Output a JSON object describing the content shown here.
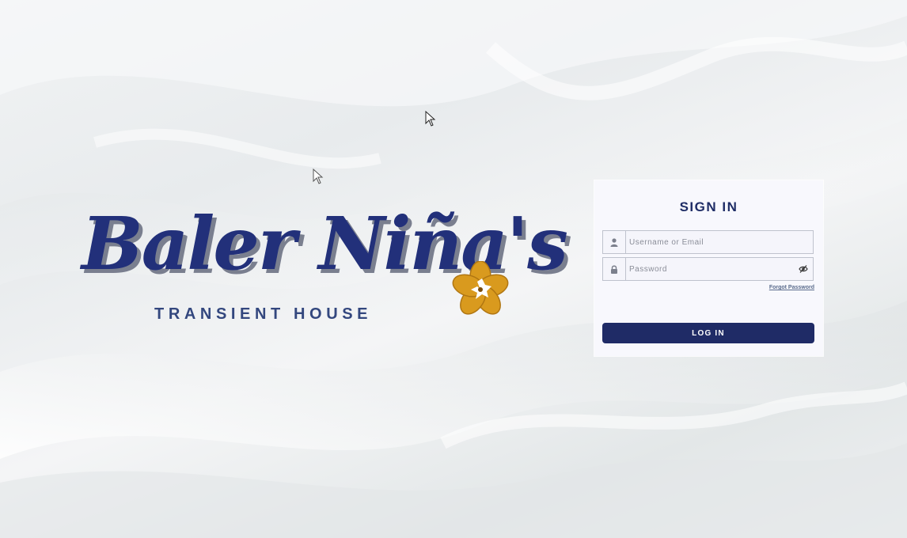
{
  "brand": {
    "name": "Baler Niña's",
    "tagline": "TRANSIENT HOUSE",
    "primary_color": "#22307a",
    "flower_color": "#d99a1e",
    "logo_icon": "hibiscus-flower"
  },
  "signin": {
    "title": "SIGN IN",
    "username": {
      "placeholder": "Username or Email",
      "value": "",
      "icon": "user-icon"
    },
    "password": {
      "placeholder": "Password",
      "value": "",
      "icon": "lock-icon",
      "toggle_icon": "eye-slash-icon"
    },
    "forgot_label": "Forgot Password",
    "login_label": "LOG IN",
    "button_color": "#1f2b66"
  }
}
